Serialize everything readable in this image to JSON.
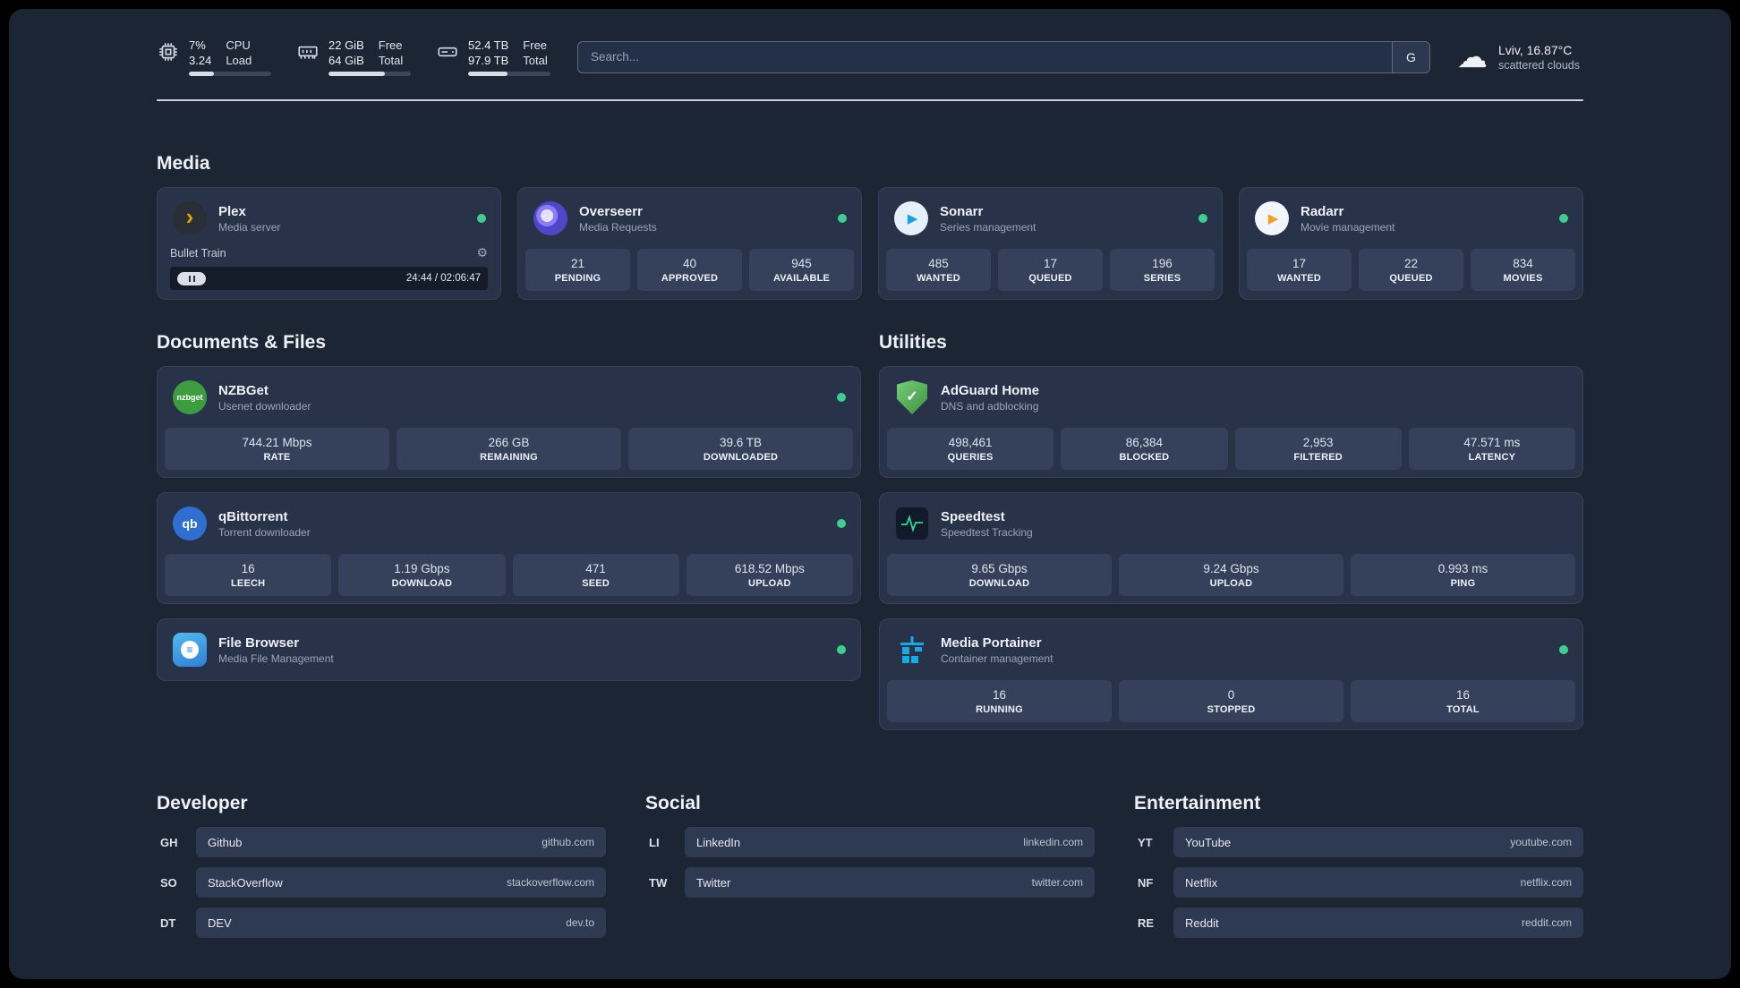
{
  "icons": {
    "plex_glyph": "›",
    "sonarr_glyph": "▶",
    "radarr_glyph": "▶",
    "gear": "⚙",
    "cloud": "☁",
    "check": "✓",
    "menu": "≡",
    "nzbget_text": "nzbget",
    "qbittorrent_text": "qb",
    "search_provider": "G"
  },
  "topbar": {
    "cpu": {
      "value_top": "7%",
      "value_bottom": "3.24",
      "label_top": "CPU",
      "label_bottom": "Load"
    },
    "memory": {
      "value_top": "22 GiB",
      "value_bottom": "64 GiB",
      "label_top": "Free",
      "label_bottom": "Total"
    },
    "disk": {
      "value_top": "52.4 TB",
      "value_bottom": "97.9 TB",
      "label_top": "Free",
      "label_bottom": "Total"
    },
    "search": {
      "placeholder": "Search..."
    },
    "weather": {
      "location": "Lviv, 16.87°C",
      "condition": "scattered clouds"
    }
  },
  "sections": {
    "media": "Media",
    "documents": "Documents & Files",
    "utilities": "Utilities",
    "developer": "Developer",
    "social": "Social",
    "entertainment": "Entertainment"
  },
  "media": {
    "plex": {
      "title": "Plex",
      "subtitle": "Media server",
      "track": "Bullet Train",
      "time": "24:44 / 02:06:47"
    },
    "overseerr": {
      "title": "Overseerr",
      "subtitle": "Media Requests",
      "stats": [
        {
          "value": "21",
          "label": "PENDING"
        },
        {
          "value": "40",
          "label": "APPROVED"
        },
        {
          "value": "945",
          "label": "AVAILABLE"
        }
      ]
    },
    "sonarr": {
      "title": "Sonarr",
      "subtitle": "Series management",
      "stats": [
        {
          "value": "485",
          "label": "WANTED"
        },
        {
          "value": "17",
          "label": "QUEUED"
        },
        {
          "value": "196",
          "label": "SERIES"
        }
      ]
    },
    "radarr": {
      "title": "Radarr",
      "subtitle": "Movie management",
      "stats": [
        {
          "value": "17",
          "label": "WANTED"
        },
        {
          "value": "22",
          "label": "QUEUED"
        },
        {
          "value": "834",
          "label": "MOVIES"
        }
      ]
    }
  },
  "documents": {
    "nzbget": {
      "title": "NZBGet",
      "subtitle": "Usenet downloader",
      "stats": [
        {
          "value": "744.21 Mbps",
          "label": "RATE"
        },
        {
          "value": "266 GB",
          "label": "REMAINING"
        },
        {
          "value": "39.6 TB",
          "label": "DOWNLOADED"
        }
      ]
    },
    "qbittorrent": {
      "title": "qBittorrent",
      "subtitle": "Torrent downloader",
      "stats": [
        {
          "value": "16",
          "label": "LEECH"
        },
        {
          "value": "1.19 Gbps",
          "label": "DOWNLOAD"
        },
        {
          "value": "471",
          "label": "SEED"
        },
        {
          "value": "618.52 Mbps",
          "label": "UPLOAD"
        }
      ]
    },
    "filebrowser": {
      "title": "File Browser",
      "subtitle": "Media File Management"
    }
  },
  "utilities": {
    "adguard": {
      "title": "AdGuard Home",
      "subtitle": "DNS and adblocking",
      "stats": [
        {
          "value": "498,461",
          "label": "QUERIES"
        },
        {
          "value": "86,384",
          "label": "BLOCKED"
        },
        {
          "value": "2,953",
          "label": "FILTERED"
        },
        {
          "value": "47.571 ms",
          "label": "LATENCY"
        }
      ]
    },
    "speedtest": {
      "title": "Speedtest",
      "subtitle": "Speedtest Tracking",
      "stats": [
        {
          "value": "9.65 Gbps",
          "label": "DOWNLOAD"
        },
        {
          "value": "9.24 Gbps",
          "label": "UPLOAD"
        },
        {
          "value": "0.993 ms",
          "label": "PING"
        }
      ]
    },
    "portainer": {
      "title": "Media Portainer",
      "subtitle": "Container management",
      "stats": [
        {
          "value": "16",
          "label": "RUNNING"
        },
        {
          "value": "0",
          "label": "STOPPED"
        },
        {
          "value": "16",
          "label": "TOTAL"
        }
      ]
    }
  },
  "bookmarks": {
    "developer": [
      {
        "abbr": "GH",
        "name": "Github",
        "url": "github.com"
      },
      {
        "abbr": "SO",
        "name": "StackOverflow",
        "url": "stackoverflow.com"
      },
      {
        "abbr": "DT",
        "name": "DEV",
        "url": "dev.to"
      }
    ],
    "social": [
      {
        "abbr": "LI",
        "name": "LinkedIn",
        "url": "linkedin.com"
      },
      {
        "abbr": "TW",
        "name": "Twitter",
        "url": "twitter.com"
      }
    ],
    "entertainment": [
      {
        "abbr": "YT",
        "name": "YouTube",
        "url": "youtube.com"
      },
      {
        "abbr": "NF",
        "name": "Netflix",
        "url": "netflix.com"
      },
      {
        "abbr": "RE",
        "name": "Reddit",
        "url": "reddit.com"
      }
    ]
  }
}
